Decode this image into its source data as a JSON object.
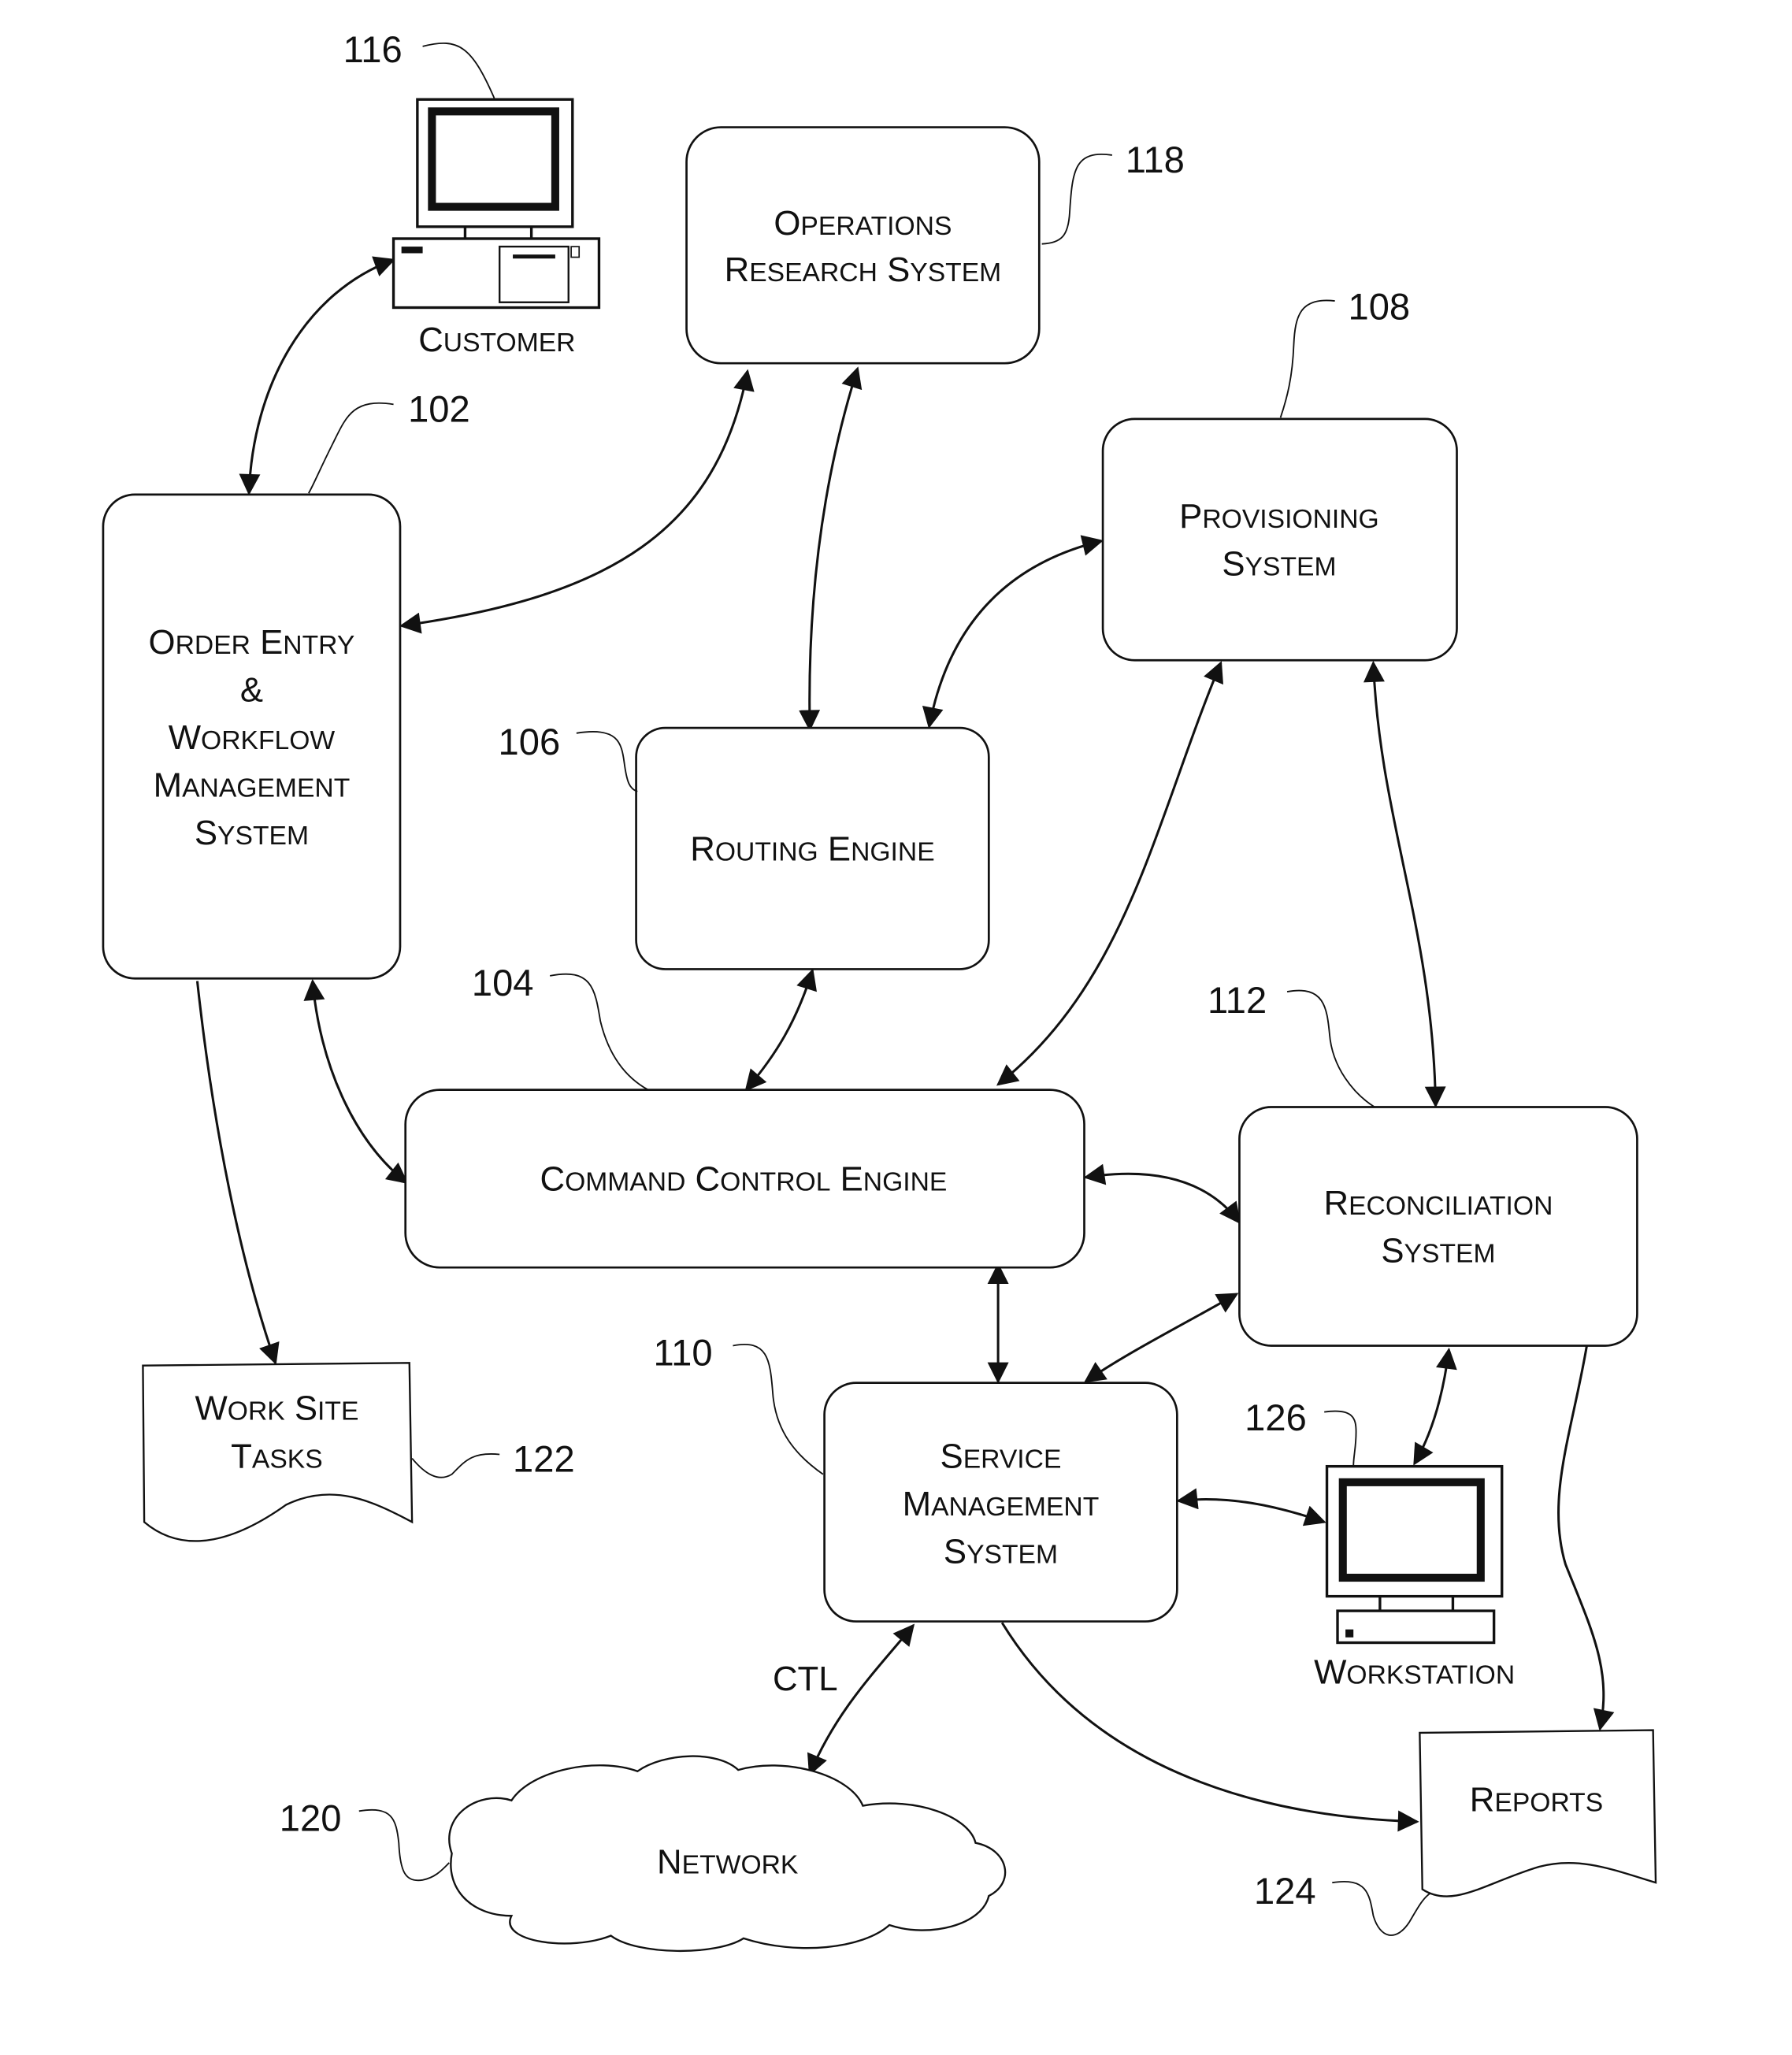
{
  "figure": {
    "nodes": {
      "order_entry": {
        "ref": "102",
        "lines": [
          "Order Entry",
          "&",
          "Workflow",
          "Management",
          "System"
        ]
      },
      "command_control": {
        "ref": "104",
        "lines": [
          "Command Control Engine"
        ]
      },
      "routing": {
        "ref": "106",
        "lines": [
          "Routing Engine"
        ]
      },
      "provisioning": {
        "ref": "108",
        "lines": [
          "Provisioning",
          "System"
        ]
      },
      "service_mgmt": {
        "ref": "110",
        "lines": [
          "Service",
          "Management",
          "System"
        ]
      },
      "reconciliation": {
        "ref": "112",
        "lines": [
          "Reconciliation",
          "System"
        ]
      },
      "customer": {
        "ref": "116",
        "label": "Customer"
      },
      "ops_research": {
        "ref": "118",
        "lines": [
          "Operations",
          "Research System"
        ]
      },
      "network": {
        "ref": "120",
        "label": "Network"
      },
      "work_site_tasks": {
        "ref": "122",
        "lines": [
          "Work Site",
          "Tasks"
        ]
      },
      "reports": {
        "ref": "124",
        "label": "Reports"
      },
      "workstation": {
        "ref": "126",
        "label": "Workstation"
      }
    },
    "edge_labels": {
      "ctl": "CTL"
    },
    "edges": [
      {
        "from": "customer",
        "to": "order_entry",
        "type": "bidirectional"
      },
      {
        "from": "order_entry",
        "to": "ops_research",
        "type": "bidirectional"
      },
      {
        "from": "ops_research",
        "to": "routing",
        "type": "bidirectional"
      },
      {
        "from": "routing",
        "to": "provisioning",
        "type": "bidirectional"
      },
      {
        "from": "provisioning",
        "to": "command_control",
        "type": "bidirectional"
      },
      {
        "from": "provisioning",
        "to": "reconciliation",
        "type": "bidirectional"
      },
      {
        "from": "order_entry",
        "to": "command_control",
        "type": "bidirectional"
      },
      {
        "from": "routing",
        "to": "command_control",
        "type": "bidirectional"
      },
      {
        "from": "command_control",
        "to": "reconciliation",
        "type": "bidirectional"
      },
      {
        "from": "command_control",
        "to": "service_mgmt",
        "type": "bidirectional"
      },
      {
        "from": "reconciliation",
        "to": "service_mgmt",
        "type": "bidirectional"
      },
      {
        "from": "reconciliation",
        "to": "workstation",
        "type": "bidirectional"
      },
      {
        "from": "service_mgmt",
        "to": "workstation",
        "type": "bidirectional"
      },
      {
        "from": "service_mgmt",
        "to": "network",
        "type": "bidirectional",
        "label": "CTL"
      },
      {
        "from": "order_entry",
        "to": "work_site_tasks",
        "type": "directed"
      },
      {
        "from": "service_mgmt",
        "to": "reports",
        "type": "directed"
      },
      {
        "from": "reconciliation",
        "to": "reports",
        "type": "directed"
      }
    ]
  }
}
